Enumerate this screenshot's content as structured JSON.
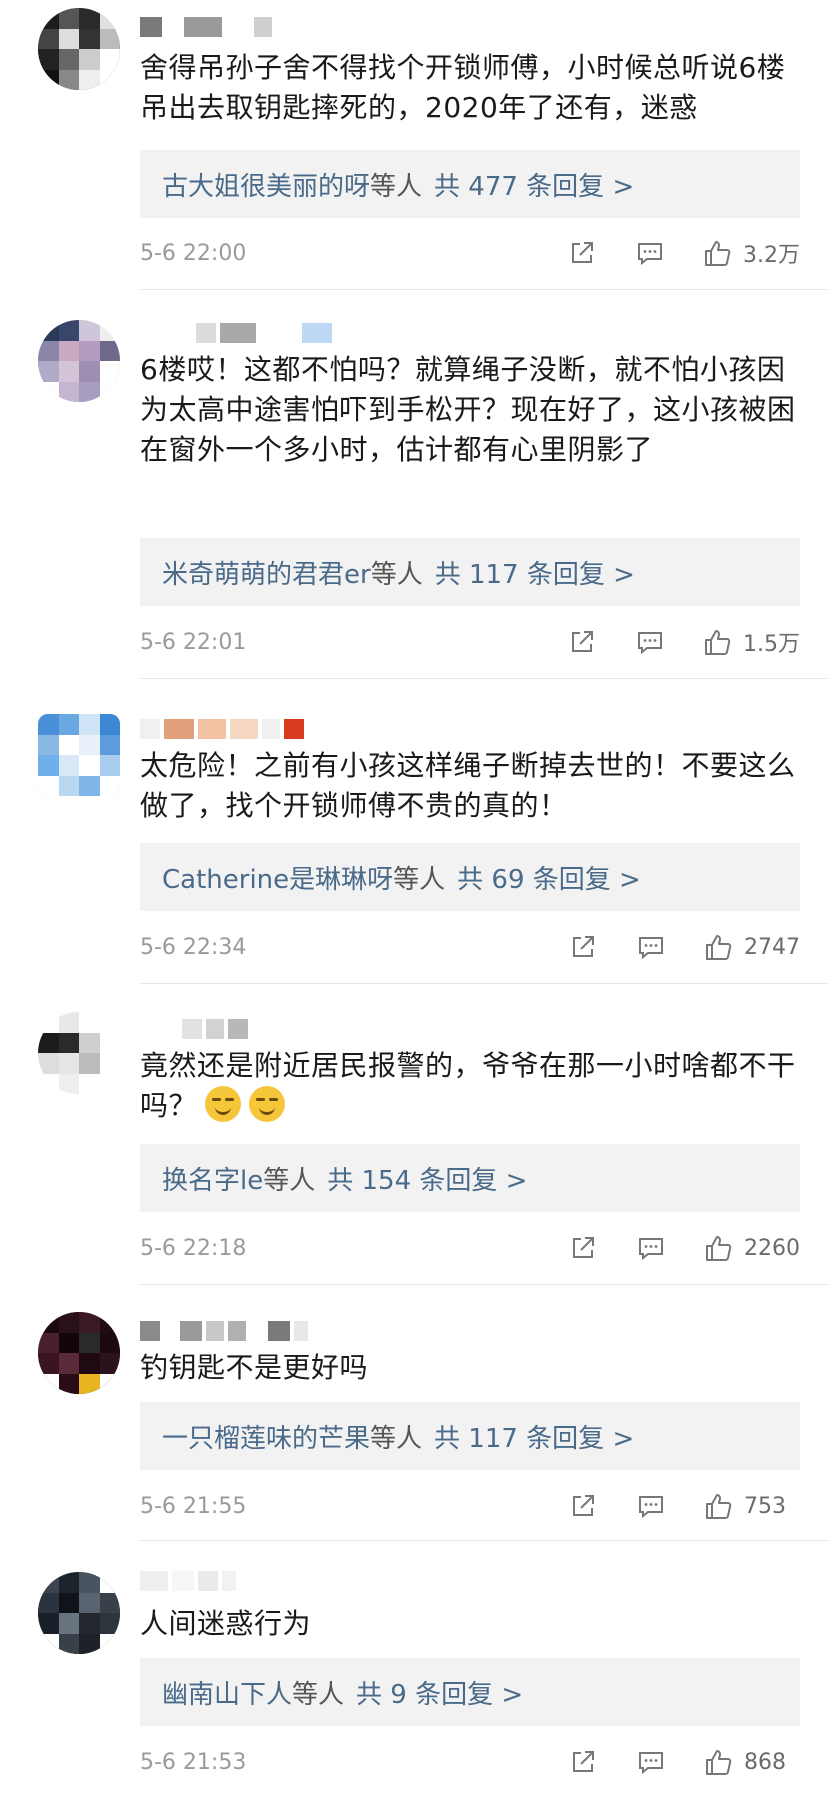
{
  "comments": [
    {
      "content": "舍得吊孙子舍不得找个开锁师傅，小时候总听说6楼吊出去取钥匙摔死的，2020年了还有，迷惑",
      "replies_who": "古大姐很美丽的呀",
      "replies_and": "等人",
      "replies_count": "共 477 条回复 >",
      "date": "5-6 22:00",
      "likes": "3.2万"
    },
    {
      "content": "6楼哎！这都不怕吗？就算绳子没断，就不怕小孩因为太高中途害怕吓到手松开？现在好了，这小孩被困在窗外一个多小时，估计都有心里阴影了",
      "replies_who": "米奇萌萌的君君er",
      "replies_and": "等人",
      "replies_count": "共 117 条回复 >",
      "date": "5-6 22:01",
      "likes": "1.5万"
    },
    {
      "content": "太危险！之前有小孩这样绳子断掉去世的！不要这么做了，找个开锁师傅不贵的真的！",
      "replies_who": "Catherine是琳琳呀",
      "replies_and": "等人",
      "replies_count": "共 69 条回复 >",
      "date": "5-6 22:34",
      "likes": "2747"
    },
    {
      "content": "竟然还是附近居民报警的，爷爷在那一小时啥都不干吗？",
      "replies_who": "换名字le",
      "replies_and": "等人",
      "replies_count": "共 154 条回复 >",
      "date": "5-6 22:18",
      "likes": "2260"
    },
    {
      "content": "钓钥匙不是更好吗",
      "replies_who": "一只榴莲味的芒果",
      "replies_and": "等人",
      "replies_count": "共 117 条回复 >",
      "date": "5-6 21:55",
      "likes": "753"
    },
    {
      "content": "人间迷惑行为",
      "replies_who": "幽南山下人",
      "replies_and": "等人",
      "replies_count": "共 9 条回复 >",
      "date": "5-6 21:53",
      "likes": "868"
    }
  ],
  "icons": {
    "share": "share-icon",
    "comment": "comment-icon",
    "like": "thumbs-up-icon"
  },
  "colors": {
    "reply_link": "#4a6a8a",
    "reply_bg": "#f2f2f2",
    "meta_text": "#9a9a9a",
    "emoji": "#f6c63a"
  }
}
